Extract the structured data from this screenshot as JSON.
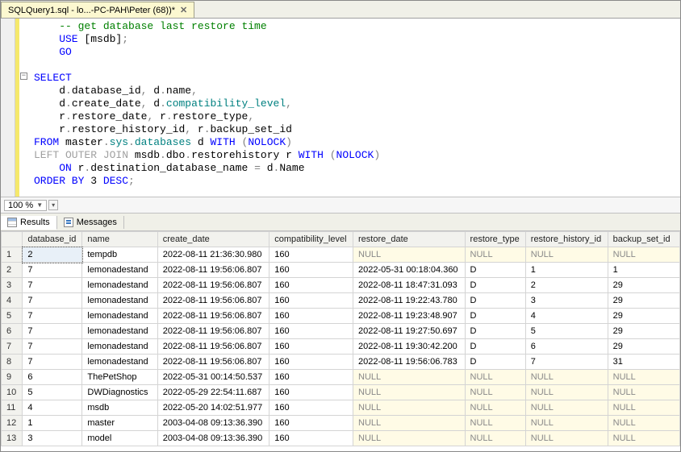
{
  "tab": {
    "title": "SQLQuery1.sql - lo...-PC-PAH\\Peter (68))*",
    "close": "✕"
  },
  "zoom": {
    "value": "100 %"
  },
  "result_tabs": {
    "results": "Results",
    "messages": "Messages"
  },
  "sql": {
    "l1": "    -- get database last restore time",
    "l2a": "    USE ",
    "l2b": "[msdb]",
    "l2c": ";",
    "l3": "    GO",
    "l4": "",
    "l5a": "SELECT",
    "l6a": "    d",
    "l6b": ".",
    "l6c": "database_id",
    "l6d": ",",
    "l6e": " d",
    "l6f": ".",
    "l6g": "name",
    "l6h": ",",
    "l7a": "    d",
    "l7b": ".",
    "l7c": "create_date",
    "l7d": ",",
    "l7e": " d",
    "l7f": ".",
    "l7g": "compatibility_level",
    "l7h": ",",
    "l8a": "    r",
    "l8b": ".",
    "l8c": "restore_date",
    "l8d": ",",
    "l8e": " r",
    "l8f": ".",
    "l8g": "restore_type",
    "l8h": ",",
    "l9a": "    r",
    "l9b": ".",
    "l9c": "restore_history_id",
    "l9d": ",",
    "l9e": " r",
    "l9f": ".",
    "l9g": "backup_set_id",
    "l10a": "FROM ",
    "l10b": "master",
    "l10c": ".",
    "l10d": "sys",
    "l10e": ".",
    "l10f": "databases",
    "l10g": " d ",
    "l10h": "WITH ",
    "l10i": "(",
    "l10j": "NOLOCK",
    "l10k": ")",
    "l11a": "LEFT OUTER JOIN ",
    "l11b": "msdb",
    "l11c": ".",
    "l11d": "dbo",
    "l11e": ".",
    "l11f": "restorehistory r ",
    "l11g": "WITH ",
    "l11h": "(",
    "l11i": "NOLOCK",
    "l11j": ")",
    "l12a": "    ON ",
    "l12b": "r",
    "l12c": ".",
    "l12d": "destination_database_name ",
    "l12e": "=",
    "l12f": " d",
    "l12g": ".",
    "l12h": "Name",
    "l13a": "ORDER BY ",
    "l13b": "3 ",
    "l13c": "DESC",
    "l13d": ";"
  },
  "columns": [
    "database_id",
    "name",
    "create_date",
    "compatibility_level",
    "restore_date",
    "restore_type",
    "restore_history_id",
    "backup_set_id"
  ],
  "rows": [
    {
      "n": "1",
      "database_id": "2",
      "name": "tempdb",
      "create_date": "2022-08-11 21:36:30.980",
      "compatibility_level": "160",
      "restore_date": null,
      "restore_type": null,
      "restore_history_id": null,
      "backup_set_id": null
    },
    {
      "n": "2",
      "database_id": "7",
      "name": "lemonadestand",
      "create_date": "2022-08-11 19:56:06.807",
      "compatibility_level": "160",
      "restore_date": "2022-05-31 00:18:04.360",
      "restore_type": "D",
      "restore_history_id": "1",
      "backup_set_id": "1"
    },
    {
      "n": "3",
      "database_id": "7",
      "name": "lemonadestand",
      "create_date": "2022-08-11 19:56:06.807",
      "compatibility_level": "160",
      "restore_date": "2022-08-11 18:47:31.093",
      "restore_type": "D",
      "restore_history_id": "2",
      "backup_set_id": "29"
    },
    {
      "n": "4",
      "database_id": "7",
      "name": "lemonadestand",
      "create_date": "2022-08-11 19:56:06.807",
      "compatibility_level": "160",
      "restore_date": "2022-08-11 19:22:43.780",
      "restore_type": "D",
      "restore_history_id": "3",
      "backup_set_id": "29"
    },
    {
      "n": "5",
      "database_id": "7",
      "name": "lemonadestand",
      "create_date": "2022-08-11 19:56:06.807",
      "compatibility_level": "160",
      "restore_date": "2022-08-11 19:23:48.907",
      "restore_type": "D",
      "restore_history_id": "4",
      "backup_set_id": "29"
    },
    {
      "n": "6",
      "database_id": "7",
      "name": "lemonadestand",
      "create_date": "2022-08-11 19:56:06.807",
      "compatibility_level": "160",
      "restore_date": "2022-08-11 19:27:50.697",
      "restore_type": "D",
      "restore_history_id": "5",
      "backup_set_id": "29"
    },
    {
      "n": "7",
      "database_id": "7",
      "name": "lemonadestand",
      "create_date": "2022-08-11 19:56:06.807",
      "compatibility_level": "160",
      "restore_date": "2022-08-11 19:30:42.200",
      "restore_type": "D",
      "restore_history_id": "6",
      "backup_set_id": "29"
    },
    {
      "n": "8",
      "database_id": "7",
      "name": "lemonadestand",
      "create_date": "2022-08-11 19:56:06.807",
      "compatibility_level": "160",
      "restore_date": "2022-08-11 19:56:06.783",
      "restore_type": "D",
      "restore_history_id": "7",
      "backup_set_id": "31"
    },
    {
      "n": "9",
      "database_id": "6",
      "name": "ThePetShop",
      "create_date": "2022-05-31 00:14:50.537",
      "compatibility_level": "160",
      "restore_date": null,
      "restore_type": null,
      "restore_history_id": null,
      "backup_set_id": null
    },
    {
      "n": "10",
      "database_id": "5",
      "name": "DWDiagnostics",
      "create_date": "2022-05-29 22:54:11.687",
      "compatibility_level": "160",
      "restore_date": null,
      "restore_type": null,
      "restore_history_id": null,
      "backup_set_id": null
    },
    {
      "n": "11",
      "database_id": "4",
      "name": "msdb",
      "create_date": "2022-05-20 14:02:51.977",
      "compatibility_level": "160",
      "restore_date": null,
      "restore_type": null,
      "restore_history_id": null,
      "backup_set_id": null
    },
    {
      "n": "12",
      "database_id": "1",
      "name": "master",
      "create_date": "2003-04-08 09:13:36.390",
      "compatibility_level": "160",
      "restore_date": null,
      "restore_type": null,
      "restore_history_id": null,
      "backup_set_id": null
    },
    {
      "n": "13",
      "database_id": "3",
      "name": "model",
      "create_date": "2003-04-08 09:13:36.390",
      "compatibility_level": "160",
      "restore_date": null,
      "restore_type": null,
      "restore_history_id": null,
      "backup_set_id": null
    }
  ],
  "null_text": "NULL"
}
